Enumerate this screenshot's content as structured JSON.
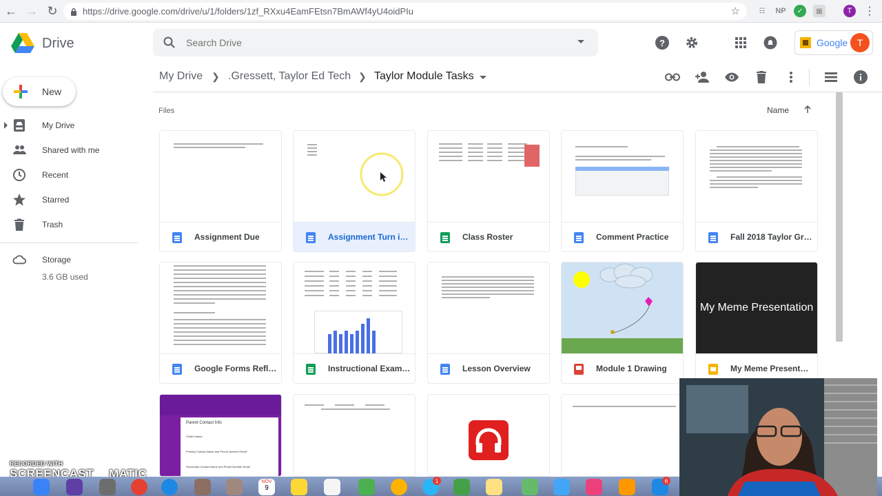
{
  "browser": {
    "url": "https://drive.google.com/drive/u/1/folders/1zf_RXxu4EamFEtsn7BmAWf4yU4oidPIu",
    "profile_initial": "T",
    "ext_np": "NP"
  },
  "header": {
    "app_name": "Drive",
    "search_placeholder": "Search Drive",
    "brand_text": "Google",
    "avatar_initial": "T"
  },
  "breadcrumb": [
    {
      "label": "My Drive"
    },
    {
      "label": ".Gressett, Taylor Ed Tech"
    },
    {
      "label": "Taylor Module Tasks"
    }
  ],
  "sidebar": {
    "new_label": "New",
    "items": [
      {
        "label": "My Drive",
        "icon": "drive-icon"
      },
      {
        "label": "Shared with me",
        "icon": "people-icon"
      },
      {
        "label": "Recent",
        "icon": "clock-icon"
      },
      {
        "label": "Starred",
        "icon": "star-icon"
      },
      {
        "label": "Trash",
        "icon": "trash-icon"
      }
    ],
    "storage_label": "Storage",
    "storage_used": "3.6 GB used"
  },
  "files": {
    "section_label": "Files",
    "sort_label": "Name",
    "items": [
      {
        "title": "Assignment Due",
        "type": "doc"
      },
      {
        "title": "Assignment Turn in ...",
        "type": "doc"
      },
      {
        "title": "Class Roster",
        "type": "sheet"
      },
      {
        "title": "Comment Practice",
        "type": "doc"
      },
      {
        "title": "Fall 2018 Taylor Gre...",
        "type": "doc"
      },
      {
        "title": "Google Forms Refle...",
        "type": "doc"
      },
      {
        "title": "Instructional Exampl...",
        "type": "sheet"
      },
      {
        "title": "Lesson Overview",
        "type": "doc"
      },
      {
        "title": "Module 1 Drawing",
        "type": "drawing"
      },
      {
        "title": "My Meme Presentat...",
        "type": "slides"
      }
    ],
    "meme_thumb_text": "My Meme Presentation",
    "form_thumb": {
      "title": "Parent Contact Info",
      "field1": "Child's Name",
      "field2": "Primary Contact Name and Phone Number Email*",
      "field3": "Secondary Contact Name and Phone Number Email"
    }
  },
  "overlay": {
    "recorded_with": "RECORDED WITH",
    "brand_left": "SCREENCAST",
    "brand_right": "MATIC"
  },
  "dock": {
    "calendar_month": "NOV",
    "calendar_day": "9",
    "badge_a": "1",
    "badge_b": "6"
  }
}
